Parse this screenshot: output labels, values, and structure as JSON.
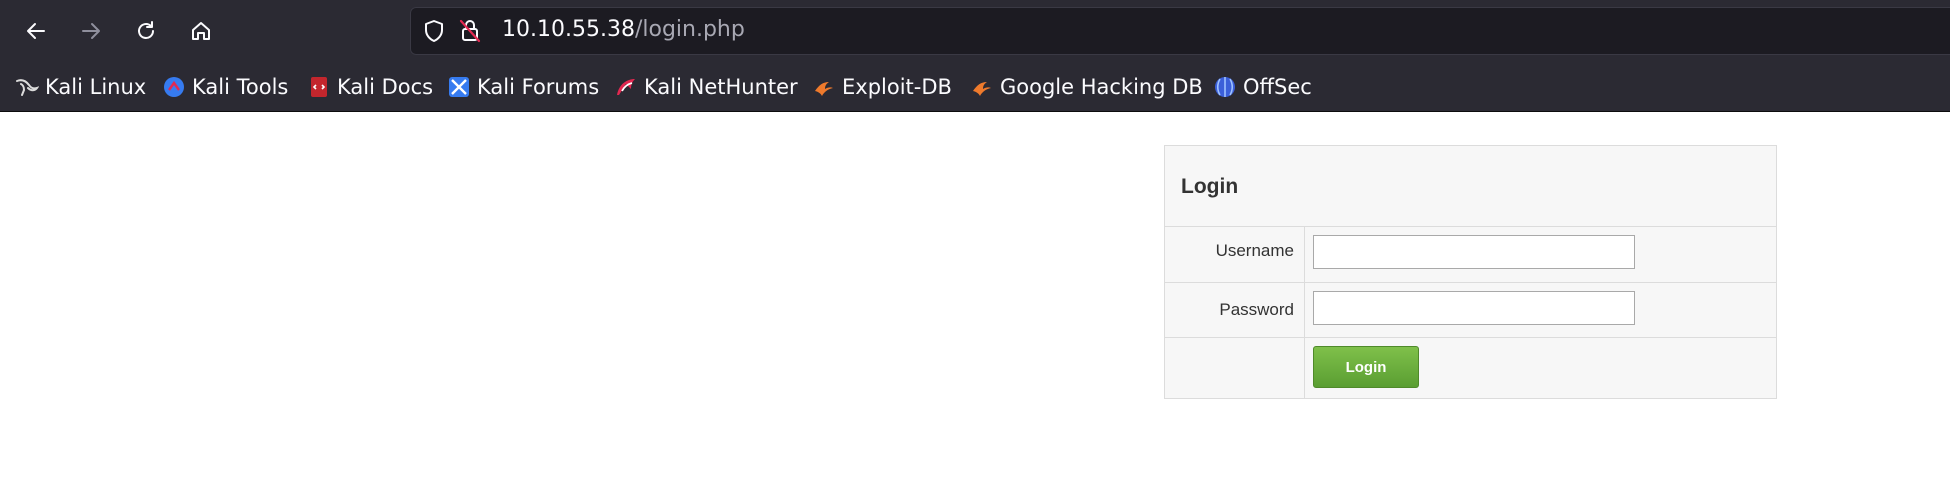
{
  "browser": {
    "url_host": "10.10.55.38",
    "url_path": "/login.php",
    "icons": [
      "back-arrow-icon",
      "forward-arrow-icon",
      "reload-icon",
      "home-icon",
      "shield-icon",
      "insecure-lock-icon"
    ]
  },
  "bookmarks": [
    {
      "label": "Kali Linux",
      "icon": "kali-dragon-icon"
    },
    {
      "label": "Kali Tools",
      "icon": "kali-tools-icon"
    },
    {
      "label": "Kali Docs",
      "icon": "kali-docs-icon"
    },
    {
      "label": "Kali Forums",
      "icon": "kali-forums-icon"
    },
    {
      "label": "Kali NetHunter",
      "icon": "nethunter-icon"
    },
    {
      "label": "Exploit-DB",
      "icon": "exploit-db-icon"
    },
    {
      "label": "Google Hacking DB",
      "icon": "ghdb-icon"
    },
    {
      "label": "OffSec",
      "icon": "offsec-icon"
    }
  ],
  "login": {
    "title": "Login",
    "username_label": "Username",
    "password_label": "Password",
    "username_value": "",
    "password_value": "",
    "submit_label": "Login",
    "accent": "#6aae3c"
  }
}
